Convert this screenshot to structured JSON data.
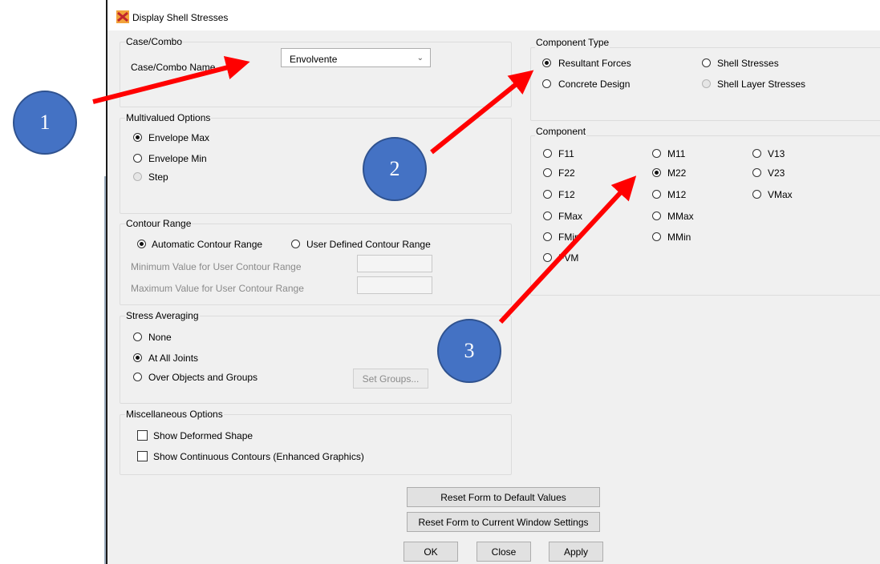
{
  "window": {
    "title": "Display Shell Stresses"
  },
  "case_combo": {
    "group_label": "Case/Combo",
    "name_label": "Case/Combo Name",
    "selected": "Envolvente"
  },
  "multivalued": {
    "group_label": "Multivalued Options",
    "options": [
      "Envelope Max",
      "Envelope Min",
      "Step"
    ],
    "selected": "Envelope Max"
  },
  "contour_range": {
    "group_label": "Contour Range",
    "automatic_label": "Automatic Contour Range",
    "user_defined_label": "User Defined Contour Range",
    "selected": "Automatic Contour Range",
    "min_label": "Minimum Value for User Contour Range",
    "max_label": "Maximum Value for User Contour Range",
    "min_value": "",
    "max_value": ""
  },
  "stress_averaging": {
    "group_label": "Stress Averaging",
    "options": [
      "None",
      "At All Joints",
      "Over Objects and Groups"
    ],
    "selected": "At All Joints",
    "set_groups_label": "Set Groups..."
  },
  "misc": {
    "group_label": "Miscellaneous Options",
    "show_deformed_label": "Show Deformed Shape",
    "show_continuous_label": "Show Continuous Contours (Enhanced Graphics)",
    "show_deformed_checked": false,
    "show_continuous_checked": false
  },
  "component_type": {
    "group_label": "Component Type",
    "options": [
      "Resultant Forces",
      "Shell Stresses",
      "Concrete Design",
      "Shell Layer Stresses"
    ],
    "selected": "Resultant Forces"
  },
  "component": {
    "group_label": "Component",
    "col1": [
      "F11",
      "F22",
      "F12",
      "FMax",
      "FMin",
      "FVM"
    ],
    "col2": [
      "M11",
      "M22",
      "M12",
      "MMax",
      "MMin"
    ],
    "col3": [
      "V13",
      "V23",
      "VMax"
    ],
    "selected": "M22"
  },
  "buttons": {
    "reset_default": "Reset Form to Default Values",
    "reset_current": "Reset Form to Current Window Settings",
    "ok": "OK",
    "close": "Close",
    "apply": "Apply"
  },
  "annotations": {
    "marker1": "1",
    "marker2": "2",
    "marker3": "3"
  },
  "colors": {
    "marker_fill": "#4472c4",
    "arrow": "#ff0000"
  }
}
